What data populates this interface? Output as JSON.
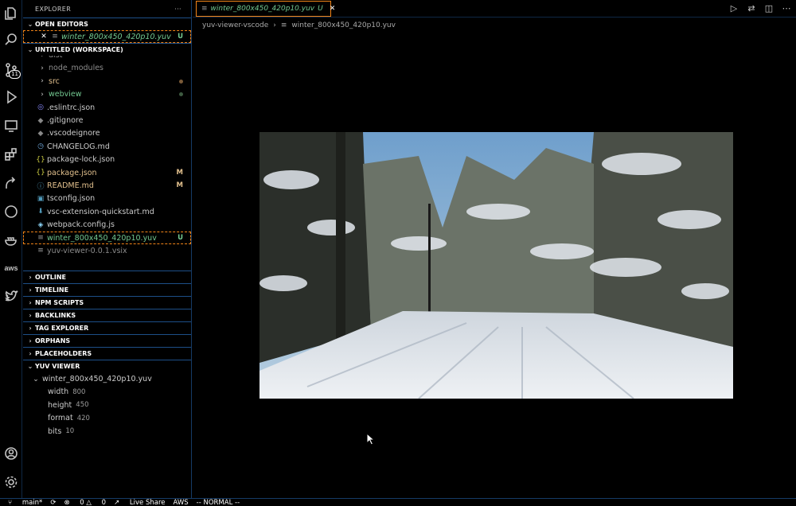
{
  "activity": {
    "source_control_badge": "11",
    "aws_label": "aws"
  },
  "sidebar": {
    "title": "EXPLORER",
    "more": "···",
    "open_editors": {
      "heading": "OPEN EDITORS",
      "items": [
        {
          "name": "winter_800x450_420p10.yuv",
          "status": "U"
        }
      ]
    },
    "workspace": {
      "heading": "UNTITLED (WORKSPACE)",
      "files": [
        {
          "name": "dist",
          "kind": "folder"
        },
        {
          "name": "node_modules",
          "kind": "folder"
        },
        {
          "name": "src",
          "kind": "folder"
        },
        {
          "name": "webview",
          "kind": "folder"
        },
        {
          "name": ".eslintrc.json",
          "icon": "gear"
        },
        {
          "name": ".gitignore",
          "icon": "diamond"
        },
        {
          "name": ".vscodeignore",
          "icon": "diamond"
        },
        {
          "name": "CHANGELOG.md",
          "icon": "clock"
        },
        {
          "name": "package-lock.json",
          "icon": "braces"
        },
        {
          "name": "package.json",
          "icon": "braces",
          "status": "M"
        },
        {
          "name": "README.md",
          "icon": "info",
          "status": "M"
        },
        {
          "name": "tsconfig.json",
          "icon": "ts"
        },
        {
          "name": "vsc-extension-quickstart.md",
          "icon": "down"
        },
        {
          "name": "webpack.config.js",
          "icon": "cube"
        },
        {
          "name": "winter_800x450_420p10.yuv",
          "icon": "lines",
          "status": "U"
        },
        {
          "name": "yuv-viewer-0.0.1.vsix",
          "icon": "lines"
        }
      ]
    },
    "sections": [
      "OUTLINE",
      "TIMELINE",
      "NPM SCRIPTS",
      "BACKLINKS",
      "TAG EXPLORER",
      "ORPHANS",
      "PLACEHOLDERS"
    ],
    "yuv_viewer": {
      "heading": "YUV VIEWER",
      "file": "winter_800x450_420p10.yuv",
      "props": [
        {
          "key": "width",
          "value": "800"
        },
        {
          "key": "height",
          "value": "450"
        },
        {
          "key": "format",
          "value": "420"
        },
        {
          "key": "bits",
          "value": "10"
        }
      ]
    }
  },
  "editor": {
    "tab_label": "winter_800x450_420p10.yuv",
    "tab_status": "U",
    "breadcrumb": [
      "yuv-viewer-vscode",
      "winter_800x450_420p10.yuv"
    ]
  },
  "status": {
    "branch": "main*",
    "problems": "0",
    "warnings": "0",
    "live_share": "Live Share",
    "aws": "AWS",
    "mode": "-- NORMAL --"
  }
}
